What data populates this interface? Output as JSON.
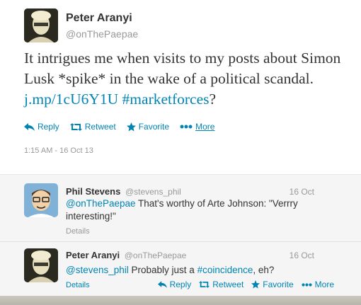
{
  "main_tweet": {
    "name": "Peter Aranyi",
    "handle": "@onThePaepae",
    "text_plain": "It intrigues me when visits to my posts about Simon Lusk *spike* in the wake of a political scandal.",
    "link": "j.mp/1cU6Y1U",
    "hashtag": "#marketforces",
    "text_end": "?",
    "actions": {
      "reply": "Reply",
      "retweet": "Retweet",
      "favorite": "Favorite",
      "more": "More"
    },
    "timestamp": "1:15 AM - 16 Oct 13"
  },
  "replies": [
    {
      "name": "Phil Stevens",
      "handle": "@stevens_phil",
      "date": "16 Oct",
      "mention": "@onThePaepae",
      "text": " That's worthy of Arte Johnson: \"Verrry interesting!\"",
      "details": "Details"
    },
    {
      "name": "Peter Aranyi",
      "handle": "@onThePaepae",
      "date": "16 Oct",
      "mention": "@stevens_phil",
      "text": " Probably just a ",
      "hashtag": "#coincidence",
      "text_end": ", eh?",
      "details": "Details",
      "actions": {
        "reply": "Reply",
        "retweet": "Retweet",
        "favorite": "Favorite",
        "more": "More"
      }
    }
  ],
  "colors": {
    "link": "#0084b4",
    "text": "#333333",
    "muted": "#999999",
    "reply_bg": "#f5f5f5"
  }
}
